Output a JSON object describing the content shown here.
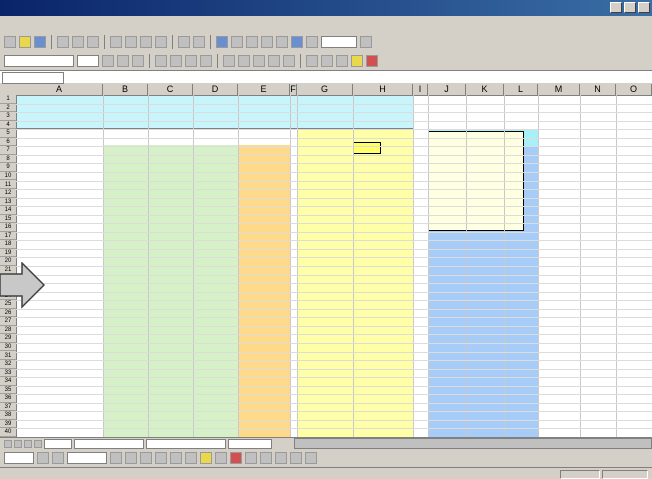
{
  "titlebar": {
    "title": ""
  },
  "menubar": {
    "items": []
  },
  "toolbar": {
    "font_name": "",
    "font_size": "",
    "zoom": ""
  },
  "formula_bar": {
    "name_box": "",
    "content": ""
  },
  "grid": {
    "columns": [
      "A",
      "B",
      "C",
      "D",
      "E",
      "F",
      "G",
      "H",
      "I",
      "J",
      "K",
      "L",
      "M",
      "N",
      "O"
    ],
    "rows": [
      "1",
      "2",
      "3",
      "4",
      "5",
      "6",
      "7",
      "8",
      "9",
      "10",
      "11",
      "12",
      "13",
      "14",
      "15",
      "16",
      "17",
      "18",
      "19",
      "20",
      "21",
      "22",
      "23",
      "24",
      "25",
      "26",
      "27",
      "28",
      "29",
      "30",
      "31",
      "32",
      "33",
      "34",
      "35",
      "36",
      "37",
      "38",
      "39",
      "40"
    ]
  },
  "instructions": {
    "heading": "",
    "line1": "",
    "line2": ""
  },
  "headers": {
    "table1": "",
    "x": "",
    "y": "",
    "z": "",
    "reflectance": "",
    "ref_data_title": "",
    "ref_source_label": "",
    "ref_source_value": "",
    "norm_ref": "",
    "wavelength": ""
  },
  "comment_box": {
    "lines": []
  },
  "sheet_tabs": {
    "tabs": []
  },
  "colors": {
    "instr_bg": "#c8f4fb",
    "green": "#d6f0c8",
    "orange": "#ffd98a",
    "yellow": "#ffffa8",
    "cyan": "#a8f0f8",
    "blue": "#a8ccf8",
    "comment": "#ffffe1"
  }
}
